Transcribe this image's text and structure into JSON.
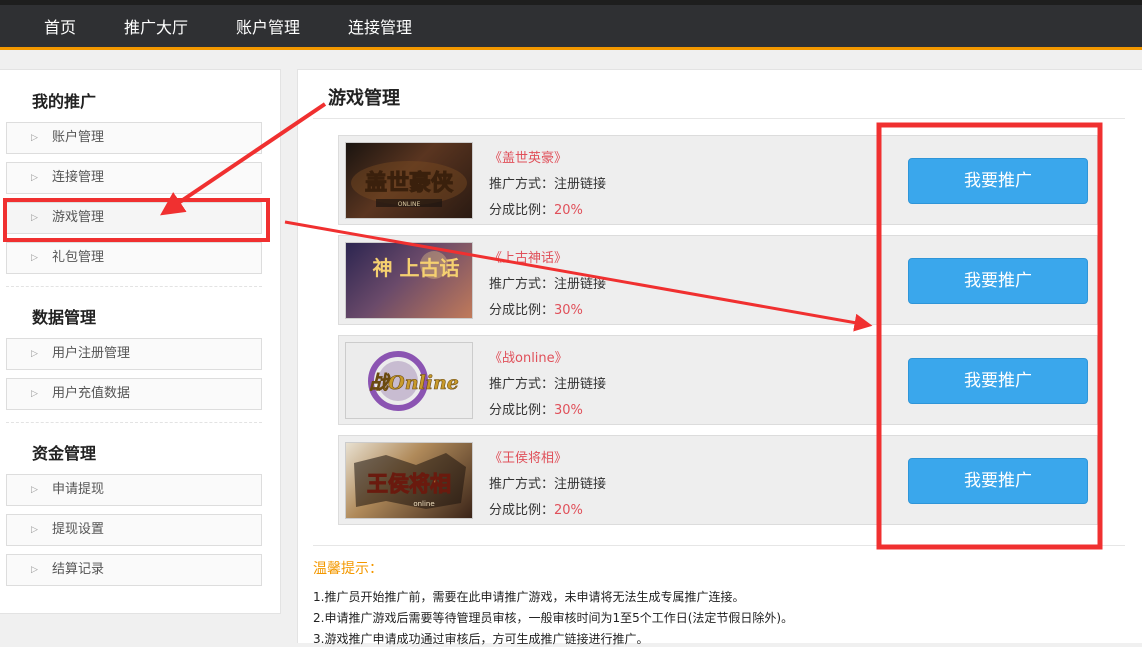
{
  "topnav": [
    "首页",
    "推广大厅",
    "账户管理",
    "连接管理"
  ],
  "sidebar": {
    "sections": [
      {
        "title": "我的推广",
        "items": [
          "账户管理",
          "连接管理",
          "游戏管理",
          "礼包管理"
        ]
      },
      {
        "title": "数据管理",
        "items": [
          "用户注册管理",
          "用户充值数据"
        ]
      },
      {
        "title": "资金管理",
        "items": [
          "申请提现",
          "提现设置",
          "结算记录"
        ]
      }
    ],
    "active_item": "游戏管理"
  },
  "main": {
    "title": "游戏管理",
    "games": [
      {
        "name": "《盖世英豪》",
        "logo_text": "盖世豪侠",
        "method_label": "推广方式：",
        "method_value": "注册链接",
        "ratio_label": "分成比例：",
        "ratio_value": "20%",
        "button": "我要推广"
      },
      {
        "name": "《上古神话》",
        "logo_text": "神 上古话",
        "method_label": "推广方式：",
        "method_value": "注册链接",
        "ratio_label": "分成比例：",
        "ratio_value": "30%",
        "button": "我要推广"
      },
      {
        "name": "《战online》",
        "logo_text": "战Online",
        "method_label": "推广方式：",
        "method_value": "注册链接",
        "ratio_label": "分成比例：",
        "ratio_value": "30%",
        "button": "我要推广"
      },
      {
        "name": "《王侯将相》",
        "logo_text": "王侯将相",
        "method_label": "推广方式：",
        "method_value": "注册链接",
        "ratio_label": "分成比例：",
        "ratio_value": "20%",
        "button": "我要推广"
      }
    ],
    "tips_title": "温馨提示：",
    "tips": [
      "1.推广员开始推广前，需要在此申请推广游戏，未申请将无法生成专属推广连接。",
      "2.申请推广游戏后需要等待管理员审核，一般审核时间为1至5个工作日(法定节假日除外)。",
      "3.游戏推广申请成功通过审核后，方可生成推广链接进行推广。"
    ]
  },
  "colors": {
    "accent": "#3aa7ec",
    "highlight": "#ff0000",
    "nav_underline": "#f39800",
    "price": "#e0505a"
  }
}
